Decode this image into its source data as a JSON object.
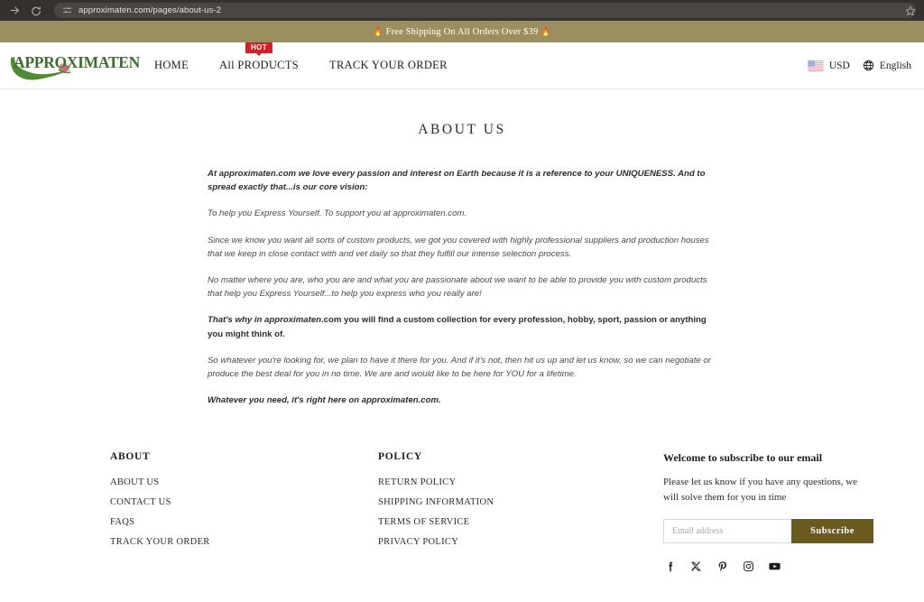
{
  "browser": {
    "url": "approximaten.com/pages/about-us-2",
    "icons": {
      "forward": "forward-arrow-icon",
      "reload": "reload-icon",
      "tune": "tune-sliders-icon",
      "bookmark": "bookmark-star-icon"
    }
  },
  "announcement": {
    "left_emoji": "🔥",
    "text": "Free Shipping On All Orders Over $39",
    "right_emoji": "🔥",
    "background": "#9c8f5f",
    "color": "#ffffff"
  },
  "header": {
    "logo_text": "APPROXIMATEN",
    "logo_color": "#3f6b2f",
    "nav": [
      {
        "label": "HOME",
        "badge": null
      },
      {
        "label": "All PRODUCTS",
        "badge": "HOT"
      },
      {
        "label": "TRACK YOUR ORDER",
        "badge": null
      }
    ],
    "currency": {
      "label": "USD",
      "icon": "us-flag-icon"
    },
    "language": {
      "label": "English",
      "icon": "globe-icon"
    },
    "badge_color": "#d0202a"
  },
  "main": {
    "title": "ABOUT US",
    "paragraphs": [
      {
        "style": "lead",
        "text": "At approximaten.com we love every passion and interest on Earth because it is a reference to your UNIQUENESS. And to spread exactly that...is our core vision:"
      },
      {
        "style": "normal",
        "text": "To help you Express Yourself. To support you at approximaten.com."
      },
      {
        "style": "normal",
        "text": "Since we know you want all sorts of custom products, we got you covered with highly professional suppliers and production houses that we keep in close contact with and vet daily so that they fulfill our intense selection process."
      },
      {
        "style": "normal",
        "text": "No matter where you are, who you are and what you are passionate about we want to be able to provide you with custom products that help you Express Yourself...to help you express who you really are!"
      },
      {
        "style": "strongline",
        "italic_part": "That's why in approximaten",
        "rest": ".com you will find a custom collection for every profession, hobby, sport, passion or anything you might think of."
      },
      {
        "style": "normal",
        "text": "So whatever you're looking for, we plan to have it there for you. And if it's not, then hit us up and let us know, so we can negotiate or produce the best deal for you in no time. We are and would like to be here for YOU for a lifetime."
      },
      {
        "style": "closing",
        "text": "Whatever you need, it's right here on approximaten.com."
      }
    ]
  },
  "footer": {
    "about": {
      "heading": "ABOUT",
      "links": [
        "ABOUT US",
        "CONTACT US",
        "FAQS",
        "TRACK YOUR ORDER"
      ]
    },
    "policy": {
      "heading": "POLICY",
      "links": [
        "RETURN POLICY",
        "SHIPPING INFORMATION",
        "TERMS OF SERVICE",
        "PRIVACY POLICY"
      ]
    },
    "newsletter": {
      "title": "Welcome to subscribe to our email",
      "body": "Please let us know if you have any questions, we will solve them for you in time",
      "email_placeholder": "Email address",
      "email_value": "",
      "subscribe_label": "Subscribe",
      "subscribe_bg": "#6b5a1e"
    },
    "social": [
      {
        "name": "facebook-icon"
      },
      {
        "name": "x-twitter-icon"
      },
      {
        "name": "pinterest-icon"
      },
      {
        "name": "instagram-icon"
      },
      {
        "name": "youtube-icon"
      }
    ]
  }
}
